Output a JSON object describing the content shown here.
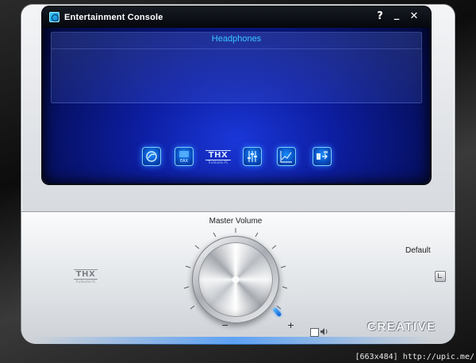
{
  "window": {
    "title": "Entertainment Console",
    "controls": [
      "?",
      "_",
      "✕"
    ]
  },
  "display": {
    "device": "Headphones"
  },
  "toolbar": {
    "icons": [
      {
        "name": "cmss-icon"
      },
      {
        "name": "eax-icon",
        "label": "EAX"
      },
      {
        "name": "thx-icon",
        "logo": "THX",
        "sub": "TruStudio PC"
      },
      {
        "name": "mixer-icon"
      },
      {
        "name": "equalizer-icon"
      },
      {
        "name": "speaker-config-icon"
      }
    ]
  },
  "lower_panel": {
    "master_volume_label": "Master Volume",
    "minus": "−",
    "plus": "+",
    "default_label": "Default",
    "thx_logo": "THX",
    "thx_sub": "TruStudio PC",
    "brand": "CREATIVE"
  },
  "watermark": "[663x484] http://upic.me/",
  "colors": {
    "screen_blue": "#0d1ea2",
    "device_text": "#38c6ff",
    "accent_blue": "#1b8eff"
  }
}
